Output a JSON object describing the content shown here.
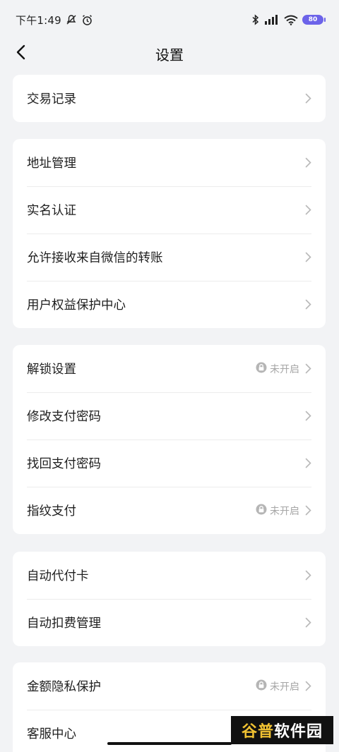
{
  "status_bar": {
    "time": "下午1:49",
    "battery": "80",
    "icons": [
      "mute-icon",
      "alarm-icon",
      "bluetooth-icon",
      "signal-icon",
      "wifi-icon",
      "battery-icon"
    ]
  },
  "nav": {
    "title": "设置",
    "back_icon": "chevron-left-icon"
  },
  "groups": [
    {
      "items": [
        {
          "label": "交易记录",
          "status": ""
        }
      ]
    },
    {
      "items": [
        {
          "label": "地址管理",
          "status": ""
        },
        {
          "label": "实名认证",
          "status": ""
        },
        {
          "label": "允许接收来自微信的转账",
          "status": ""
        },
        {
          "label": "用户权益保护中心",
          "status": ""
        }
      ]
    },
    {
      "items": [
        {
          "label": "解锁设置",
          "status": "未开启"
        },
        {
          "label": "修改支付密码",
          "status": ""
        },
        {
          "label": "找回支付密码",
          "status": ""
        },
        {
          "label": "指纹支付",
          "status": "未开启"
        }
      ]
    },
    {
      "items": [
        {
          "label": "自动代付卡",
          "status": ""
        },
        {
          "label": "自动扣费管理",
          "status": ""
        }
      ]
    },
    {
      "items": [
        {
          "label": "金额隐私保护",
          "status": "未开启"
        },
        {
          "label": "客服中心",
          "status": ""
        }
      ]
    }
  ],
  "watermark": {
    "part1": "谷普",
    "part2": "软件园"
  },
  "colors": {
    "background": "#f2f3f5",
    "card": "#ffffff",
    "battery": "#6c63e9",
    "muted_text": "#a6a6a6"
  }
}
